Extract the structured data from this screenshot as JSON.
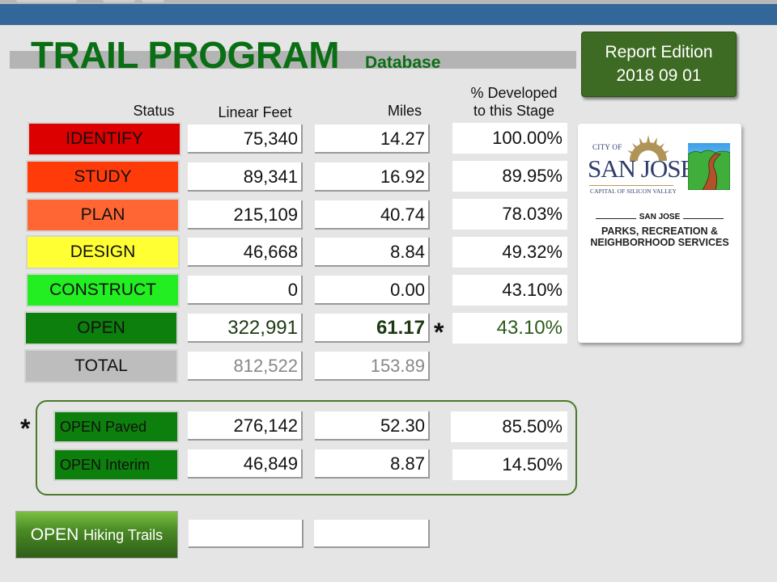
{
  "header": {
    "title": "TRAIL PROGRAM",
    "subtitle": "Database",
    "report_button": {
      "line1": "Report Edition",
      "line2": "2018 09 01"
    }
  },
  "columns": {
    "status": "Status",
    "linear_feet": "Linear Feet",
    "miles": "Miles",
    "pct_line1": "% Developed",
    "pct_line2": "to this Stage"
  },
  "colors": {
    "title_green": "#0a6e14",
    "topbar_blue": "#336699",
    "identify": "#dd0000",
    "study": "#ff3b0a",
    "plan": "#ff6633",
    "design": "#ffff33",
    "construct": "#22ee22",
    "open": "#0c7f0c",
    "total": "#bdbdbd"
  },
  "rows": [
    {
      "status": "IDENTIFY",
      "linear_feet": "75,340",
      "miles": "14.27",
      "pct": "100.00%"
    },
    {
      "status": "STUDY",
      "linear_feet": "89,341",
      "miles": "16.92",
      "pct": "89.95%"
    },
    {
      "status": "PLAN",
      "linear_feet": "215,109",
      "miles": "40.74",
      "pct": "78.03%"
    },
    {
      "status": "DESIGN",
      "linear_feet": "46,668",
      "miles": "8.84",
      "pct": "49.32%"
    },
    {
      "status": "CONSTRUCT",
      "linear_feet": "0",
      "miles": "0.00",
      "pct": "43.10%"
    },
    {
      "status": "OPEN",
      "linear_feet": "322,991",
      "miles": "61.17",
      "pct": "43.10%",
      "footnote": "*"
    },
    {
      "status": "TOTAL",
      "linear_feet": "812,522",
      "miles": "153.89"
    }
  ],
  "open_breakdown": {
    "footnote": "*",
    "rows": [
      {
        "status": "OPEN Paved",
        "linear_feet": "276,142",
        "miles": "52.30",
        "pct": "85.50%"
      },
      {
        "status": "OPEN Interim",
        "linear_feet": "46,849",
        "miles": "8.87",
        "pct": "14.50%"
      }
    ]
  },
  "hiking": {
    "label_main": "OPEN",
    "label_small": "Hiking Trails",
    "linear_feet": "",
    "miles": ""
  },
  "logo": {
    "city_of": "CITY OF",
    "city_name": "SAN JOSE",
    "tagline": "CAPITAL OF SILICON VALLEY",
    "dept_city": "SAN JOSE",
    "dept_line1": "PARKS, RECREATION &",
    "dept_line2": "NEIGHBORHOOD SERVICES"
  }
}
